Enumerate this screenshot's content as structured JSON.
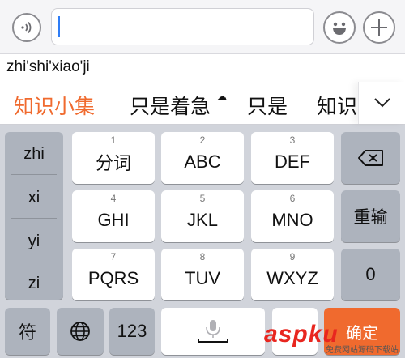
{
  "input": {
    "value": "",
    "placeholder": ""
  },
  "composition": {
    "pinyin": "zhi'shi'xiao'ji"
  },
  "candidates": [
    "知识小集",
    "只是着急",
    "只是",
    "知识"
  ],
  "pinyin_options": [
    "zhi",
    "xi",
    "yi",
    "zi"
  ],
  "keys": {
    "row1": [
      {
        "num": "1",
        "label": "分词"
      },
      {
        "num": "2",
        "label": "ABC"
      },
      {
        "num": "3",
        "label": "DEF"
      }
    ],
    "row2": [
      {
        "num": "4",
        "label": "GHI"
      },
      {
        "num": "5",
        "label": "JKL"
      },
      {
        "num": "6",
        "label": "MNO"
      }
    ],
    "row3": [
      {
        "num": "7",
        "label": "PQRS"
      },
      {
        "num": "8",
        "label": "TUV"
      },
      {
        "num": "9",
        "label": "WXYZ"
      }
    ],
    "retype": "重输",
    "zero": "0",
    "symbols": "符",
    "numbers": "123",
    "confirm_partial": "确定"
  },
  "watermark": {
    "brand": "aspku",
    "sub": "免费网站源码下载站"
  },
  "colors": {
    "candidate_highlight": "#f06a2e",
    "caret": "#2f7df6",
    "keyboard_bg": "#d1d4db",
    "watermark": "#e8261f"
  }
}
